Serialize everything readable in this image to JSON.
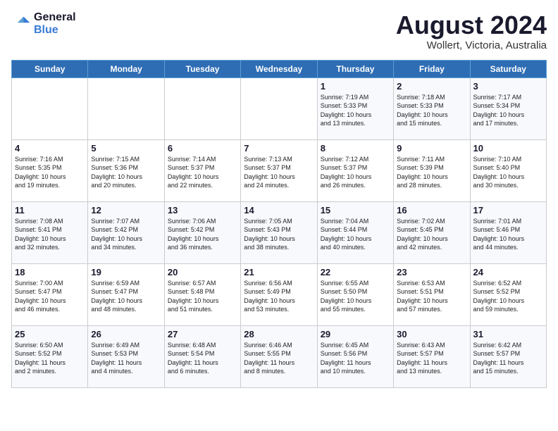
{
  "header": {
    "logo_line1": "General",
    "logo_line2": "Blue",
    "month_year": "August 2024",
    "location": "Wollert, Victoria, Australia"
  },
  "days_of_week": [
    "Sunday",
    "Monday",
    "Tuesday",
    "Wednesday",
    "Thursday",
    "Friday",
    "Saturday"
  ],
  "weeks": [
    [
      {
        "day": "",
        "info": ""
      },
      {
        "day": "",
        "info": ""
      },
      {
        "day": "",
        "info": ""
      },
      {
        "day": "",
        "info": ""
      },
      {
        "day": "1",
        "info": "Sunrise: 7:19 AM\nSunset: 5:33 PM\nDaylight: 10 hours\nand 13 minutes."
      },
      {
        "day": "2",
        "info": "Sunrise: 7:18 AM\nSunset: 5:33 PM\nDaylight: 10 hours\nand 15 minutes."
      },
      {
        "day": "3",
        "info": "Sunrise: 7:17 AM\nSunset: 5:34 PM\nDaylight: 10 hours\nand 17 minutes."
      }
    ],
    [
      {
        "day": "4",
        "info": "Sunrise: 7:16 AM\nSunset: 5:35 PM\nDaylight: 10 hours\nand 19 minutes."
      },
      {
        "day": "5",
        "info": "Sunrise: 7:15 AM\nSunset: 5:36 PM\nDaylight: 10 hours\nand 20 minutes."
      },
      {
        "day": "6",
        "info": "Sunrise: 7:14 AM\nSunset: 5:37 PM\nDaylight: 10 hours\nand 22 minutes."
      },
      {
        "day": "7",
        "info": "Sunrise: 7:13 AM\nSunset: 5:37 PM\nDaylight: 10 hours\nand 24 minutes."
      },
      {
        "day": "8",
        "info": "Sunrise: 7:12 AM\nSunset: 5:37 PM\nDaylight: 10 hours\nand 26 minutes."
      },
      {
        "day": "9",
        "info": "Sunrise: 7:11 AM\nSunset: 5:39 PM\nDaylight: 10 hours\nand 28 minutes."
      },
      {
        "day": "10",
        "info": "Sunrise: 7:10 AM\nSunset: 5:40 PM\nDaylight: 10 hours\nand 30 minutes."
      }
    ],
    [
      {
        "day": "11",
        "info": "Sunrise: 7:08 AM\nSunset: 5:41 PM\nDaylight: 10 hours\nand 32 minutes."
      },
      {
        "day": "12",
        "info": "Sunrise: 7:07 AM\nSunset: 5:42 PM\nDaylight: 10 hours\nand 34 minutes."
      },
      {
        "day": "13",
        "info": "Sunrise: 7:06 AM\nSunset: 5:42 PM\nDaylight: 10 hours\nand 36 minutes."
      },
      {
        "day": "14",
        "info": "Sunrise: 7:05 AM\nSunset: 5:43 PM\nDaylight: 10 hours\nand 38 minutes."
      },
      {
        "day": "15",
        "info": "Sunrise: 7:04 AM\nSunset: 5:44 PM\nDaylight: 10 hours\nand 40 minutes."
      },
      {
        "day": "16",
        "info": "Sunrise: 7:02 AM\nSunset: 5:45 PM\nDaylight: 10 hours\nand 42 minutes."
      },
      {
        "day": "17",
        "info": "Sunrise: 7:01 AM\nSunset: 5:46 PM\nDaylight: 10 hours\nand 44 minutes."
      }
    ],
    [
      {
        "day": "18",
        "info": "Sunrise: 7:00 AM\nSunset: 5:47 PM\nDaylight: 10 hours\nand 46 minutes."
      },
      {
        "day": "19",
        "info": "Sunrise: 6:59 AM\nSunset: 5:47 PM\nDaylight: 10 hours\nand 48 minutes."
      },
      {
        "day": "20",
        "info": "Sunrise: 6:57 AM\nSunset: 5:48 PM\nDaylight: 10 hours\nand 51 minutes."
      },
      {
        "day": "21",
        "info": "Sunrise: 6:56 AM\nSunset: 5:49 PM\nDaylight: 10 hours\nand 53 minutes."
      },
      {
        "day": "22",
        "info": "Sunrise: 6:55 AM\nSunset: 5:50 PM\nDaylight: 10 hours\nand 55 minutes."
      },
      {
        "day": "23",
        "info": "Sunrise: 6:53 AM\nSunset: 5:51 PM\nDaylight: 10 hours\nand 57 minutes."
      },
      {
        "day": "24",
        "info": "Sunrise: 6:52 AM\nSunset: 5:52 PM\nDaylight: 10 hours\nand 59 minutes."
      }
    ],
    [
      {
        "day": "25",
        "info": "Sunrise: 6:50 AM\nSunset: 5:52 PM\nDaylight: 11 hours\nand 2 minutes."
      },
      {
        "day": "26",
        "info": "Sunrise: 6:49 AM\nSunset: 5:53 PM\nDaylight: 11 hours\nand 4 minutes."
      },
      {
        "day": "27",
        "info": "Sunrise: 6:48 AM\nSunset: 5:54 PM\nDaylight: 11 hours\nand 6 minutes."
      },
      {
        "day": "28",
        "info": "Sunrise: 6:46 AM\nSunset: 5:55 PM\nDaylight: 11 hours\nand 8 minutes."
      },
      {
        "day": "29",
        "info": "Sunrise: 6:45 AM\nSunset: 5:56 PM\nDaylight: 11 hours\nand 10 minutes."
      },
      {
        "day": "30",
        "info": "Sunrise: 6:43 AM\nSunset: 5:57 PM\nDaylight: 11 hours\nand 13 minutes."
      },
      {
        "day": "31",
        "info": "Sunrise: 6:42 AM\nSunset: 5:57 PM\nDaylight: 11 hours\nand 15 minutes."
      }
    ]
  ]
}
